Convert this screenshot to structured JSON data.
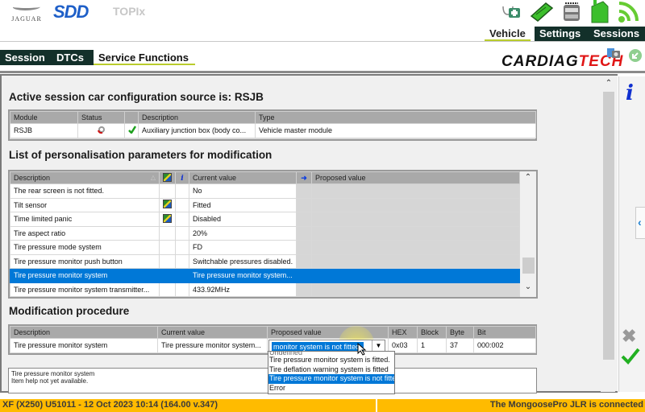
{
  "header": {
    "brand": "JAGUAR",
    "app_name": "SDD",
    "topix_label": "TOPIx",
    "status_icons": [
      "stethoscope-medkit-icon",
      "battery-charger-icon",
      "vci-device-icon",
      "battery-icon",
      "wifi-signal-icon"
    ],
    "top_tabs": [
      {
        "label": "Vehicle",
        "active": true
      },
      {
        "label": "Settings",
        "active": false
      },
      {
        "label": "Sessions",
        "active": false
      }
    ],
    "main_tabs": [
      {
        "label": "Session",
        "active": false
      },
      {
        "label": "DTCs",
        "active": false
      },
      {
        "label": "Service Functions",
        "active": true
      }
    ],
    "watermark": {
      "part1": "CARDIAG",
      "part2": "TECH"
    }
  },
  "config_section": {
    "title": "Active session car configuration source is: RSJB",
    "columns": [
      "Module",
      "Status",
      "",
      "Description",
      "Type"
    ],
    "rows": [
      {
        "module": "RSJB",
        "status_icon": "module-status-icon",
        "check_icon": "green-check-icon",
        "description": "Auxiliary junction box (body co...",
        "type": "Vehicle master module"
      }
    ]
  },
  "params_section": {
    "title": "List of personalisation parameters for modification",
    "columns": {
      "description": "Description",
      "current": "Current value",
      "proposed": "Proposed value"
    },
    "rows": [
      {
        "description": "The rear screen is not fitted.",
        "config_icon": false,
        "current": "No",
        "selected": false
      },
      {
        "description": "Tilt sensor",
        "config_icon": true,
        "current": "Fitted",
        "selected": false
      },
      {
        "description": "Time limited panic",
        "config_icon": true,
        "current": "Disabled",
        "selected": false
      },
      {
        "description": "Tire aspect ratio",
        "config_icon": false,
        "current": "20%",
        "selected": false
      },
      {
        "description": "Tire pressure mode system",
        "config_icon": false,
        "current": "FD",
        "selected": false
      },
      {
        "description": "Tire pressure monitor push button",
        "config_icon": false,
        "current": "Switchable pressures disabled.",
        "selected": false
      },
      {
        "description": "Tire pressure monitor system",
        "config_icon": false,
        "current": "Tire pressure monitor system...",
        "selected": true
      },
      {
        "description": "Tire pressure monitor system transmitter...",
        "config_icon": false,
        "current": "433.92MHz",
        "selected": false
      }
    ]
  },
  "modification_section": {
    "title": "Modification procedure",
    "columns": [
      "Description",
      "Current value",
      "Proposed value",
      "HEX",
      "Block",
      "Byte",
      "Bit"
    ],
    "row": {
      "description": "Tire pressure monitor system",
      "current": "Tire pressure monitor system...",
      "proposed": "monitor system is not fitted.",
      "hex": "0x03",
      "block": "1",
      "byte": "37",
      "bit": "000:002"
    },
    "dropdown_options": [
      {
        "label": "Undefined",
        "selected": false
      },
      {
        "label": "Tire pressure monitor system is fitted.",
        "selected": false
      },
      {
        "label": "Tire deflation warning system is fitted",
        "selected": false
      },
      {
        "label": "Tire pressure monitor system is not fitted.",
        "selected": true
      },
      {
        "label": "Error",
        "selected": false
      }
    ]
  },
  "help": {
    "line1": "Tire pressure monitor system",
    "line2": "Item help not yet available."
  },
  "status_bar": {
    "left": "XF (X250) U51011 - 12 Oct 2023 10:14 (164.00 v.347)",
    "right": "The MongoosePro JLR is connected"
  },
  "colors": {
    "accent_dark_green": "#13302a",
    "tab_underline": "#b9cc2c",
    "selection_blue": "#0078d7",
    "status_bar": "#ffbb00",
    "sdd_blue": "#1e5fc8"
  }
}
